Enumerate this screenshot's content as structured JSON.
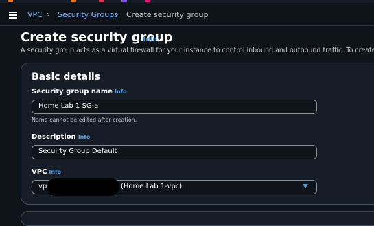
{
  "accent_colors": {
    "top_squares": [
      "#ec7211",
      "#dd344c",
      "#8c4fff",
      "#e7157b"
    ],
    "link": "#89b4ff",
    "info": "#539fe5",
    "background": "#0f141a",
    "panel": "#161d26"
  },
  "breadcrumb": {
    "items": [
      {
        "label": "VPC"
      },
      {
        "label": "Security Groups"
      }
    ],
    "current": "Create security group"
  },
  "page": {
    "title": "Create security group",
    "title_info": "Info",
    "description": "A security group acts as a virtual firewall for your instance to control inbound and outbound traffic. To create"
  },
  "basic_details": {
    "heading": "Basic details",
    "name_field": {
      "label": "Security group name",
      "info": "Info",
      "value": "Home Lab 1 SG-a",
      "constraint": "Name cannot be edited after creation."
    },
    "description_field": {
      "label": "Description",
      "info": "Info",
      "value": "Secuirty Group Default"
    },
    "vpc_field": {
      "label": "VPC",
      "info": "Info",
      "value_prefix": "vp",
      "value_suffix": "(Home Lab 1-vpc)",
      "icon": "caret-down-icon"
    }
  }
}
